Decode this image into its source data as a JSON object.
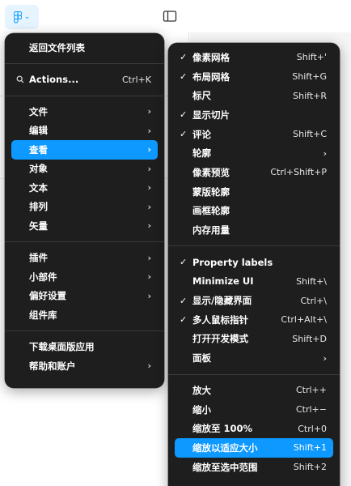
{
  "colors": {
    "accent": "#0d99ff",
    "menu_bg": "#1e1e1e",
    "separator": "#3a3a3a"
  },
  "toolbar": {
    "logo_icon": "figma-logo-icon",
    "chevron_icon": "chevron-down-icon",
    "panel_icon": "sidebar-toggle-icon"
  },
  "main_menu": {
    "back": "返回文件列表",
    "actions": {
      "label": "Actions...",
      "shortcut": "Ctrl+K"
    },
    "items": [
      {
        "label": "文件"
      },
      {
        "label": "编辑"
      },
      {
        "label": "查看"
      },
      {
        "label": "对象"
      },
      {
        "label": "文本"
      },
      {
        "label": "排列"
      },
      {
        "label": "矢量"
      }
    ],
    "items2": [
      {
        "label": "插件"
      },
      {
        "label": "小部件"
      },
      {
        "label": "偏好设置"
      },
      {
        "label": "组件库"
      }
    ],
    "items3": [
      {
        "label": "下载桌面版应用"
      },
      {
        "label": "帮助和账户"
      }
    ],
    "arrow": "›",
    "check": "✓"
  },
  "view_menu": {
    "group1": [
      {
        "label": "像素网格",
        "shortcut": "Shift+'"
      },
      {
        "label": "布局网格",
        "shortcut": "Shift+G"
      },
      {
        "label": "标尺",
        "shortcut": "Shift+R"
      },
      {
        "label": "显示切片",
        "shortcut": ""
      },
      {
        "label": "评论",
        "shortcut": "Shift+C"
      },
      {
        "label": "轮廓",
        "shortcut": ""
      },
      {
        "label": "像素预览",
        "shortcut": "Ctrl+Shift+P"
      },
      {
        "label": "蒙版轮廓",
        "shortcut": ""
      },
      {
        "label": "画框轮廓",
        "shortcut": ""
      },
      {
        "label": "内存用量",
        "shortcut": ""
      }
    ],
    "group2": [
      {
        "label": "Property labels",
        "shortcut": ""
      },
      {
        "label": "Minimize UI",
        "shortcut": "Shift+\\"
      },
      {
        "label": "显示/隐藏界面",
        "shortcut": "Ctrl+\\"
      },
      {
        "label": "多人鼠标指针",
        "shortcut": "Ctrl+Alt+\\"
      },
      {
        "label": "打开开发模式",
        "shortcut": "Shift+D"
      },
      {
        "label": "面板",
        "shortcut": ""
      }
    ],
    "group3": [
      {
        "label": "放大",
        "shortcut": "Ctrl++"
      },
      {
        "label": "缩小",
        "shortcut": "Ctrl+−"
      },
      {
        "label": "缩放至 100%",
        "shortcut": "Ctrl+0"
      },
      {
        "label": "缩放以适应大小",
        "shortcut": "Shift+1"
      },
      {
        "label": "缩放至选中范围",
        "shortcut": "Shift+2"
      }
    ]
  }
}
